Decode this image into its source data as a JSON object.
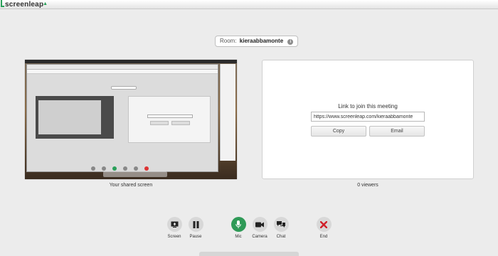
{
  "app": {
    "logo": "screenleap"
  },
  "room": {
    "label": "Room:",
    "name": "kieraabbamonte"
  },
  "shared_screen": {
    "caption": "Your shared screen"
  },
  "join": {
    "title": "Link to join this meeting",
    "url": "https://www.screenleap.com/kieraabbamonte",
    "copy_label": "Copy",
    "email_label": "Email",
    "viewers": "0 viewers"
  },
  "toolbar": [
    {
      "name": "screen",
      "label": "Screen",
      "icon": "screen-share-icon"
    },
    {
      "name": "pause",
      "label": "Pause",
      "icon": "pause-icon"
    },
    {
      "name": "mic",
      "label": "Mic",
      "icon": "microphone-icon"
    },
    {
      "name": "camera",
      "label": "Camera",
      "icon": "camera-icon"
    },
    {
      "name": "chat",
      "label": "Chat",
      "icon": "chat-icon"
    },
    {
      "name": "end",
      "label": "End",
      "icon": "close-icon"
    }
  ],
  "colors": {
    "accent_green": "#2f9a57",
    "end_red": "#d0202a",
    "background": "#ececec"
  }
}
